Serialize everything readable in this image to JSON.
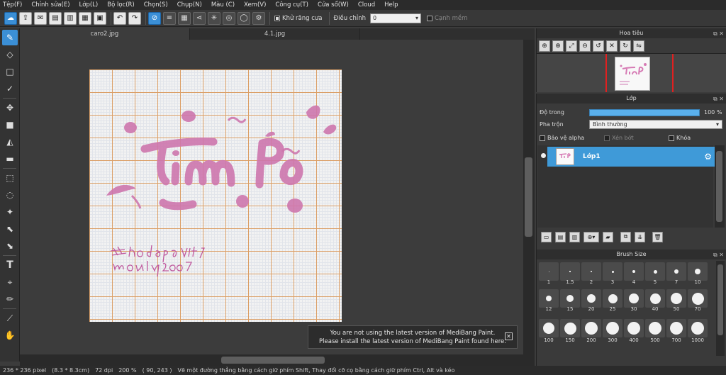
{
  "menu": [
    "Tệp(F)",
    "Chỉnh sửa(E)",
    "Lớp(L)",
    "Bộ lọc(R)",
    "Chọn(S)",
    "Chụp(N)",
    "Màu (C)",
    "Xem(V)",
    "Công cụ(T)",
    "Cửa sổ(W)",
    "Cloud",
    "Help"
  ],
  "toolbar": {
    "antialias_label": "Khử răng cưa",
    "adjust_label": "Điều chỉnh",
    "adjust_value": "0",
    "smooth_label": "Cạnh mềm"
  },
  "tabs": [
    "caro2.jpg",
    "4.1.jpg"
  ],
  "notice": {
    "line1": "You are not using the latest version of MediBang Paint.",
    "line2": "Please install the latest version of MediBang Paint found here."
  },
  "status": {
    "size": "236 * 236 pixel",
    "cm": "(8.3 * 8.3cm)",
    "dpi": "72 dpi",
    "zoom": "200 %",
    "coords": "( 90, 243 )",
    "hint": "Vẽ một đường thẳng bằng cách giữ phím Shift, Thay đổi cỡ cọ bằng cách giữ phím Ctrl, Alt và kéo"
  },
  "navigator": {
    "title": "Hoa tiêu"
  },
  "layer_panel": {
    "title": "Lớp",
    "opacity_label": "Độ trong",
    "opacity_value": "100 %",
    "blend_label": "Pha trộn",
    "blend_value": "Bình thường",
    "protect_alpha": "Bảo vệ alpha",
    "clipping": "Xén bớt",
    "lock": "Khóa",
    "layers": [
      {
        "name": "Lớp1"
      }
    ]
  },
  "brush_panel": {
    "title": "Brush Size",
    "sizes": [
      "1",
      "1.5",
      "2",
      "3",
      "4",
      "5",
      "7",
      "10",
      "12",
      "15",
      "20",
      "25",
      "30",
      "40",
      "50",
      "70",
      "100",
      "150",
      "200",
      "300",
      "400",
      "500",
      "700",
      "1000"
    ]
  },
  "colors": {
    "accent": "#3b8fd6",
    "ink": "#d67ab4",
    "grid": "#e4a56a"
  }
}
